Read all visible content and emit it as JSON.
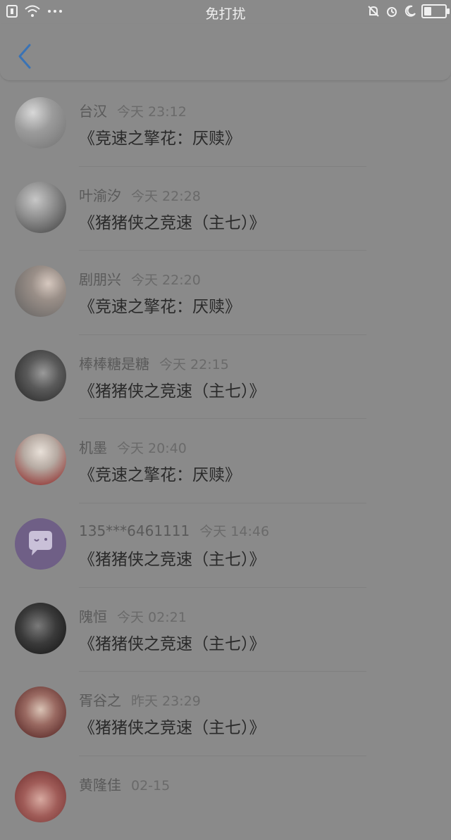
{
  "status_bar": {
    "title": "免打扰",
    "left_icons": [
      "sim-icon",
      "wifi-icon",
      "more-dots-icon"
    ],
    "right_icons": [
      "mute-bell-icon",
      "alarm-icon",
      "moon-icon",
      "battery-icon"
    ],
    "battery_level": 0.35
  },
  "header": {
    "back_icon": "chevron-left-icon",
    "accent": "#3a73b5"
  },
  "messages": [
    {
      "name": "台汉",
      "time": "今天 23:12",
      "text": "《竞速之擎花：厌赎》",
      "avatar_colors": [
        "#d8d8d8",
        "#707070"
      ]
    },
    {
      "name": "叶渝汐",
      "time": "今天 22:28",
      "text": "《猪猪侠之竞速（主七）》",
      "avatar_colors": [
        "#c7c7c7",
        "#3c3c3c"
      ]
    },
    {
      "name": "剧朋兴",
      "time": "今天 22:20",
      "text": "《竞速之擎花：厌赎》",
      "avatar_colors": [
        "#5f5f5f",
        "#d6c8bf"
      ]
    },
    {
      "name": "棒棒糖是糖",
      "time": "今天 22:15",
      "text": "《猪猪侠之竞速（主七）》",
      "avatar_colors": [
        "#222222",
        "#9a9a9a"
      ]
    },
    {
      "name": "机墨",
      "time": "今天 20:40",
      "text": "《竞速之擎花：厌赎》",
      "avatar_colors": [
        "#e8e0d8",
        "#8b1b1b"
      ]
    },
    {
      "name": "135***6461111",
      "time": "今天 14:46",
      "text": "《猪猪侠之竞速（主七）》",
      "avatar_colors": [
        "#6f5f86",
        "#c9c0d8"
      ]
    },
    {
      "name": "隗恒",
      "time": "今天 02:21",
      "text": "《猪猪侠之竞速（主七）》",
      "avatar_colors": [
        "#101010",
        "#7a7a7a"
      ]
    },
    {
      "name": "胥谷之",
      "time": "昨天 23:29",
      "text": "《猪猪侠之竞速（主七）》",
      "avatar_colors": [
        "#4a1a1a",
        "#d9c3b5"
      ]
    },
    {
      "name": "黄隆佳",
      "time": "02-15",
      "text": "",
      "avatar_colors": [
        "#6b2c2c",
        "#d7a9a0"
      ]
    }
  ]
}
